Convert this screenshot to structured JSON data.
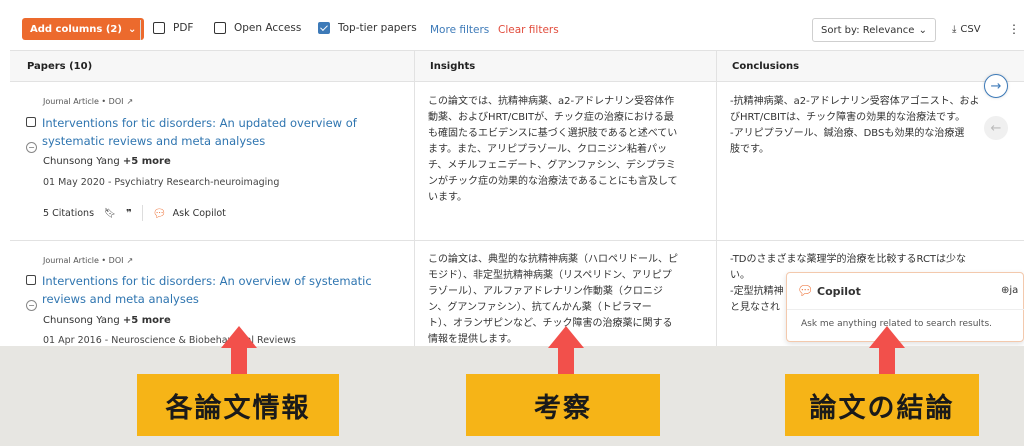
{
  "toolbar": {
    "add_columns": "Add columns (2)",
    "filters": [
      {
        "label": "PDF",
        "checked": false
      },
      {
        "label": "Open Access",
        "checked": false
      },
      {
        "label": "Top-tier papers",
        "checked": true
      }
    ],
    "more_filters": "More filters",
    "clear_filters": "Clear filters",
    "sort_label": "Sort by: Relevance",
    "csv_label": "CSV"
  },
  "table": {
    "headers": [
      "Papers (10)",
      "Insights",
      "Conclusions"
    ],
    "rows": [
      {
        "meta": "Journal Article • DOI",
        "title_line1": "Interventions for tic disorders: An updated overview of",
        "title_line2": "systematic reviews and meta analyses",
        "author": "Chunsong Yang",
        "more": "+5 more",
        "date": "01 May 2020 - Psychiatry Research-neuroimaging",
        "citations": "5 Citations",
        "ask": "Ask Copilot",
        "insights": [
          "この論文では、抗精神病薬、a2-アドレナリン受容体作",
          "動薬、およびHRT/CBITが、チック症の治療における最",
          "も確固たるエビデンスに基づく選択肢であると述べてい",
          "ます。また、アリピプラゾール、クロニジン粘着パッ",
          "チ、メチルフェニデート、グアンファシン、デシプラミ",
          "ンがチック症の効果的な治療法であることにも言及して",
          "います。"
        ],
        "conclusions": [
          "-抗精神病薬、a2-アドレナリン受容体アゴニスト、およ",
          "びHRT/CBITは、チック障害の効果的な治療法です。",
          "-アリピプラゾール、鍼治療、DBSも効果的な治療選",
          "肢です。"
        ]
      },
      {
        "meta": "Journal Article • DOI",
        "title_line1": "Interventions for tic disorders: An overview of systematic",
        "title_line2": "reviews and meta analyses",
        "author": "Chunsong Yang",
        "more": "+5 more",
        "date": "01 Apr 2016 - Neuroscience & Biobehavioral Reviews",
        "insights": [
          "この論文は、典型的な抗精神病薬（ハロペリドール、ピ",
          "モジド）、非定型抗精神病薬（リスペリドン、アリピプ",
          "ラゾール）、アルファアドレナリン作動薬（クロニジ",
          "ン、グアンファシン）、抗てんかん薬（トピラマー",
          "ト）、オランザピンなど、チック障害の治療薬に関する",
          "情報を提供します。"
        ],
        "conclusions": [
          "-TDのさまざまな薬理学的治療を比較するRCTは少な",
          "い。",
          "-定型抗精神",
          "と見なされ"
        ]
      }
    ]
  },
  "copilot": {
    "title": "Copilot",
    "lang": "ja",
    "placeholder": "Ask me anything related to search results."
  },
  "annotations": [
    "各論文情報",
    "考察",
    "論文の結論"
  ],
  "colors": {
    "accent": "#ec6a2d",
    "link": "#2f75b0",
    "clear": "#e14c3c",
    "label_bg": "#f6b417",
    "arrow": "#f2504b"
  }
}
